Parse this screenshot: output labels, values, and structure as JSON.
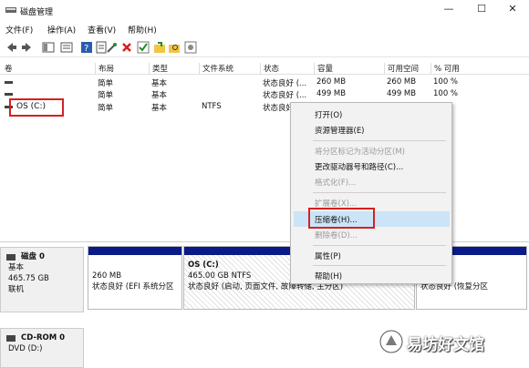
{
  "window": {
    "title": "磁盘管理",
    "controls": [
      "—",
      "☐",
      "✕"
    ]
  },
  "menubar": [
    "文件(F)",
    "操作(A)",
    "查看(V)",
    "帮助(H)"
  ],
  "volume_table": {
    "headers": [
      "卷",
      "布局",
      "类型",
      "文件系统",
      "状态",
      "容量",
      "可用空间",
      "% 可用"
    ],
    "rows": [
      {
        "name": "",
        "layout": "简单",
        "type": "基本",
        "fs": "",
        "status": "状态良好 (...",
        "capacity": "260 MB",
        "free": "260 MB",
        "pct": "100 %"
      },
      {
        "name": "",
        "layout": "简单",
        "type": "基本",
        "fs": "",
        "status": "状态良好 (...",
        "capacity": "499 MB",
        "free": "499 MB",
        "pct": "100 %"
      },
      {
        "name": "OS (C:)",
        "layout": "简单",
        "type": "基本",
        "fs": "NTFS",
        "status": "状态良好 (...",
        "capacity": "",
        "free": "",
        "pct": ""
      }
    ]
  },
  "context_menu": {
    "items": [
      {
        "label": "打开(O)",
        "enabled": true
      },
      {
        "label": "资源管理器(E)",
        "enabled": true
      },
      {
        "label": "将分区标记为活动分区(M)",
        "enabled": false
      },
      {
        "label": "更改驱动器号和路径(C)...",
        "enabled": true
      },
      {
        "label": "格式化(F)...",
        "enabled": false
      },
      {
        "label": "扩展卷(X)...",
        "enabled": false
      },
      {
        "label": "压缩卷(H)...",
        "enabled": true
      },
      {
        "label": "删除卷(D)...",
        "enabled": false
      },
      {
        "label": "属性(P)",
        "enabled": true
      },
      {
        "label": "帮助(H)",
        "enabled": true
      }
    ]
  },
  "disks": [
    {
      "name": "磁盘 0",
      "type": "基本",
      "size": "465.75 GB",
      "status": "联机"
    },
    {
      "name": "CD-ROM 0",
      "type": "DVD (D:)"
    }
  ],
  "partitions": [
    {
      "name": "",
      "size": "260 MB",
      "status": "状态良好 (EFI 系统分区"
    },
    {
      "name": "OS  (C:)",
      "size": "465.00 GB NTFS",
      "status": "状态良好 (启动, 页面文件, 故障转储, 主分区)"
    },
    {
      "name": "",
      "size": "",
      "status": "状态良好 (恢复分区"
    }
  ],
  "watermark": "易坊好文馆",
  "colors": {
    "partition_bar": "#0a1b88",
    "highlight_red": "#d62020",
    "menu_highlight": "#cce4f7"
  }
}
